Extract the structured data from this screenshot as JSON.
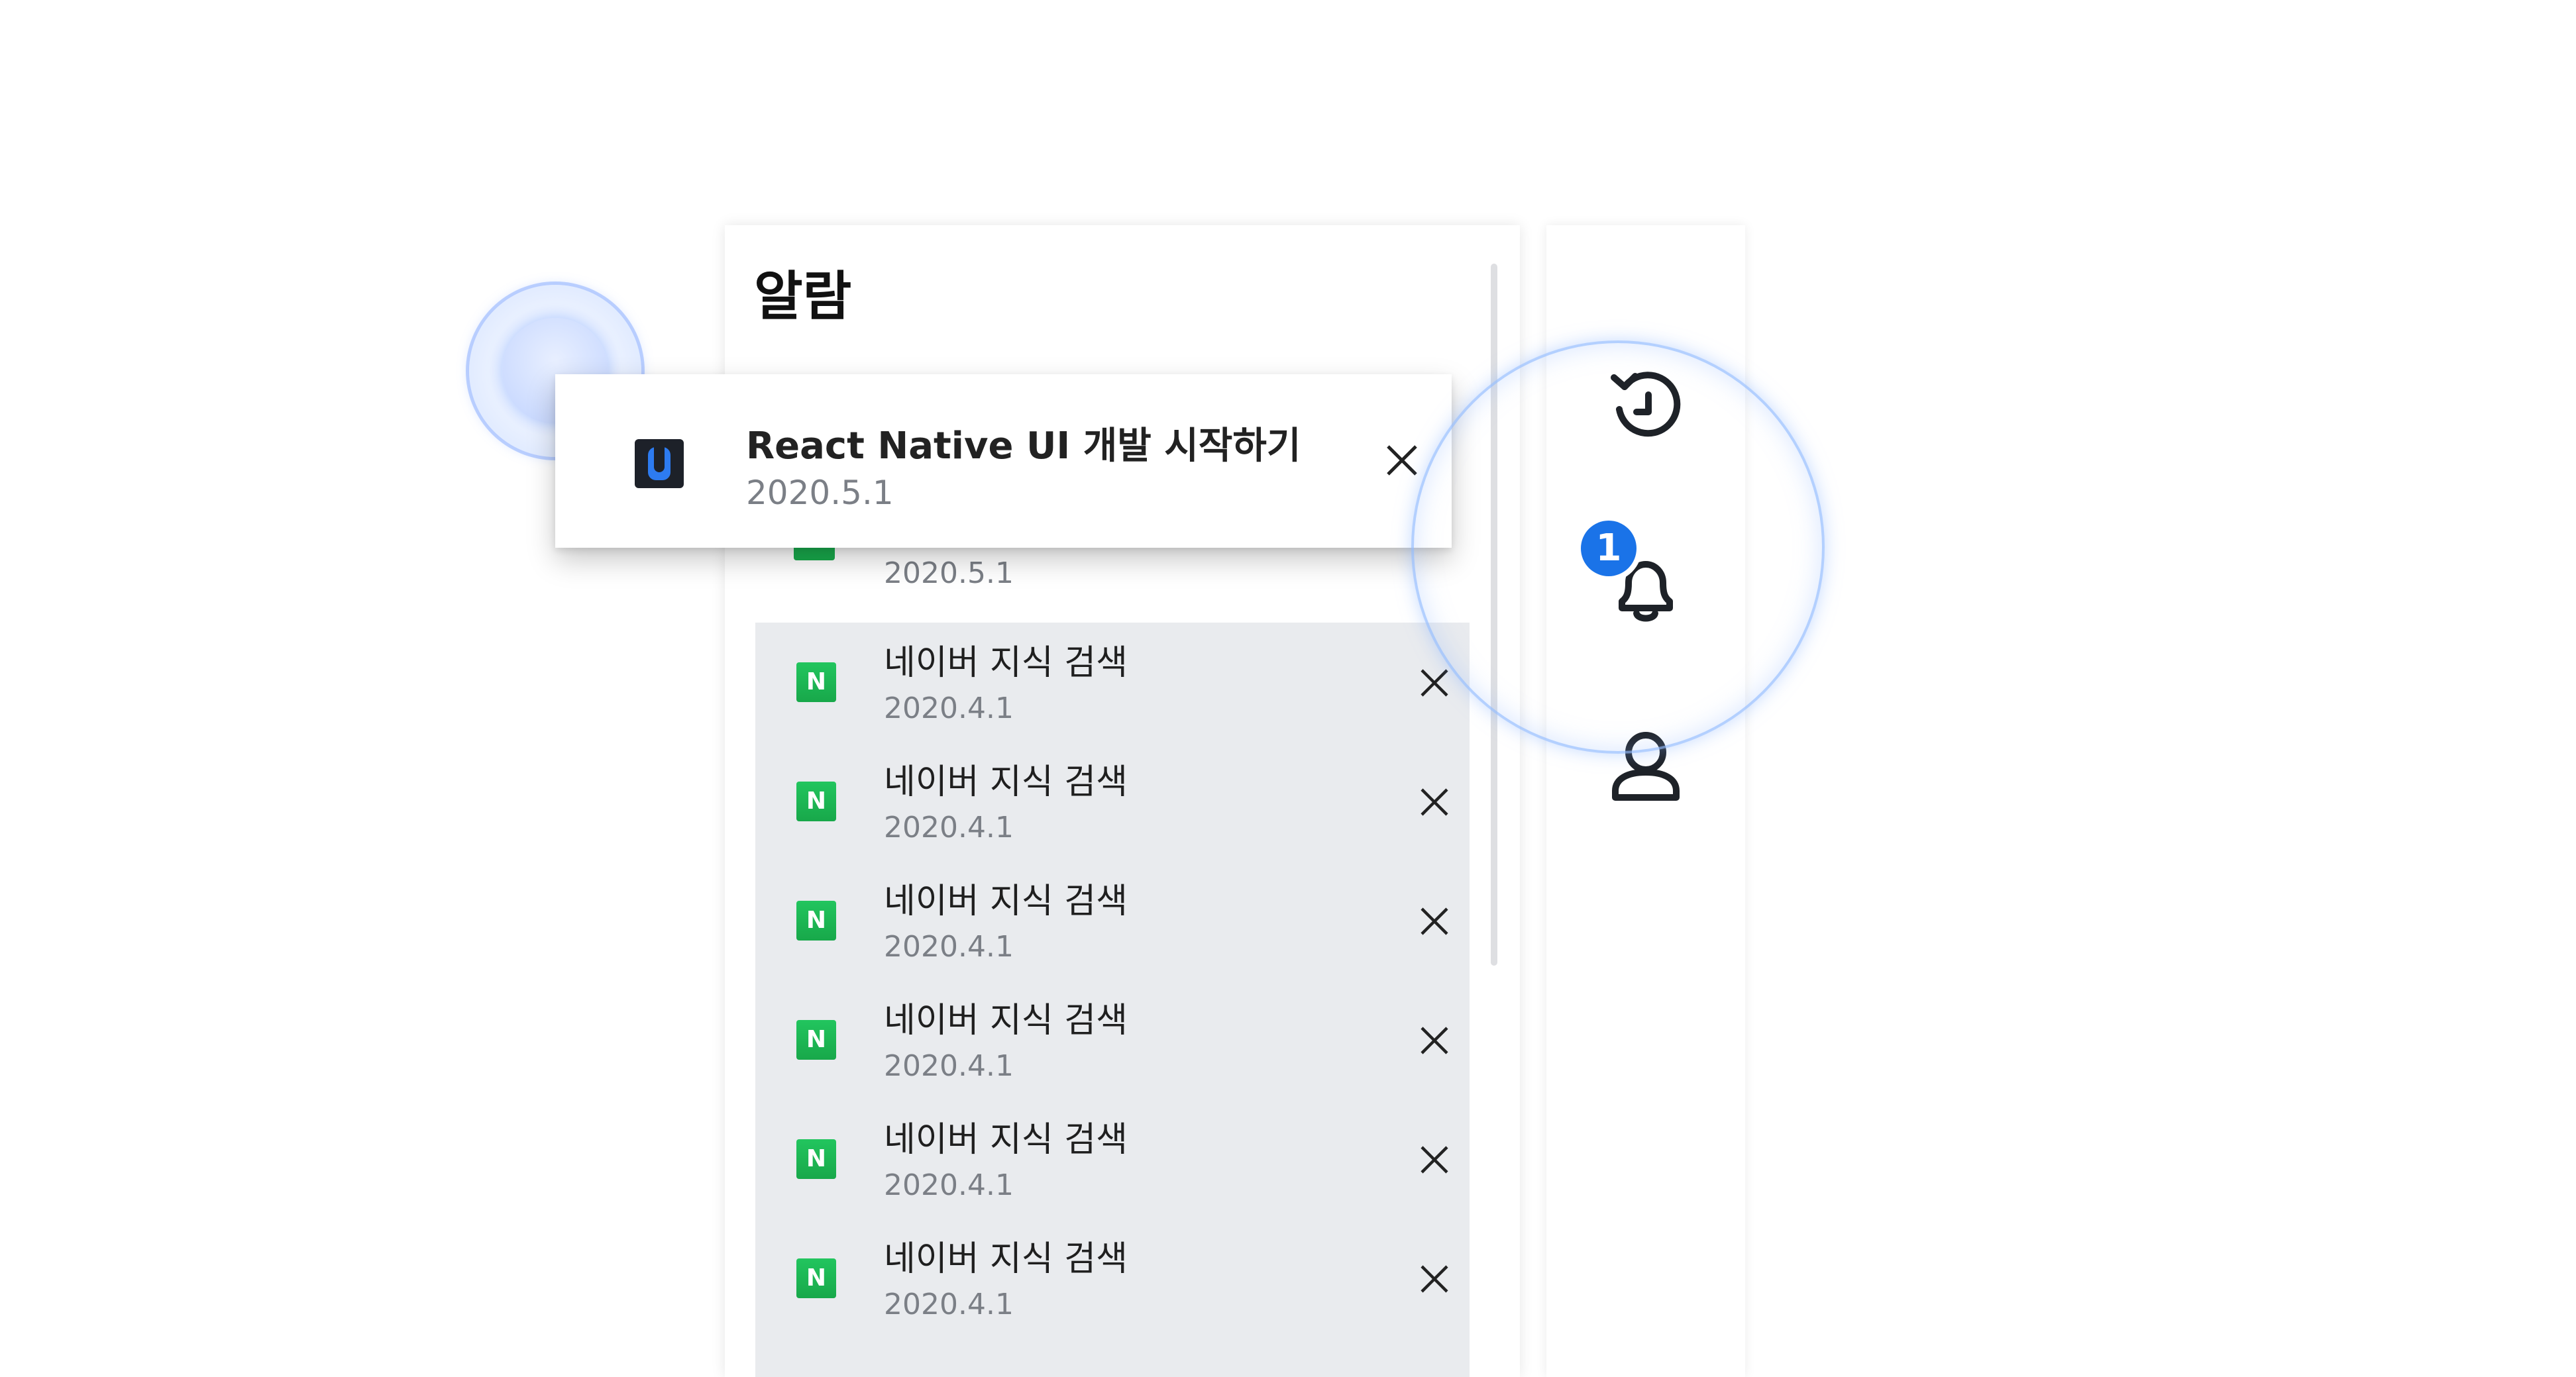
{
  "panel": {
    "title": "알람"
  },
  "toast": {
    "title": "React Native UI 개발 시작하기",
    "date": "2020.5.1",
    "icon": "app-logo-icon"
  },
  "peek_item": {
    "date": "2020.5.1"
  },
  "notifications": [
    {
      "title": "네이버 지식 검색",
      "date": "2020.4.1",
      "icon_letter": "N"
    },
    {
      "title": "네이버 지식 검색",
      "date": "2020.4.1",
      "icon_letter": "N"
    },
    {
      "title": "네이버 지식 검색",
      "date": "2020.4.1",
      "icon_letter": "N"
    },
    {
      "title": "네이버 지식 검색",
      "date": "2020.4.1",
      "icon_letter": "N"
    },
    {
      "title": "네이버 지식 검색",
      "date": "2020.4.1",
      "icon_letter": "N"
    },
    {
      "title": "네이버 지식 검색",
      "date": "2020.4.1",
      "icon_letter": "N"
    }
  ],
  "sidebar": {
    "items": [
      {
        "icon": "history-icon"
      },
      {
        "icon": "bell-icon",
        "badge": "1"
      },
      {
        "icon": "user-icon"
      }
    ]
  },
  "colors": {
    "accent": "#1a73e8",
    "naver_green": "#1ec800",
    "list_bg": "#e9ebee",
    "date_text": "#7b7f86"
  }
}
